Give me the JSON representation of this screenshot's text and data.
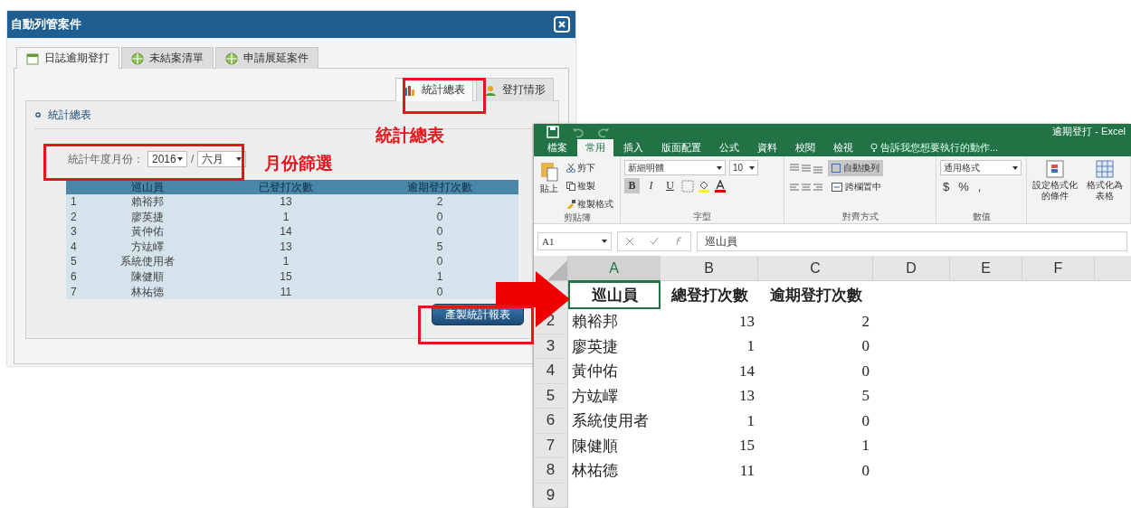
{
  "dialog": {
    "title": "自動列管案件",
    "tabs": [
      {
        "label": "日誌逾期登打",
        "selected": true
      },
      {
        "label": "未結案清單",
        "selected": false
      },
      {
        "label": "申請展延案件",
        "selected": false
      }
    ],
    "sub_tabs": [
      {
        "label": "統計總表",
        "selected": true
      },
      {
        "label": "登打情形",
        "selected": false
      }
    ],
    "section_title": "統計總表",
    "filter": {
      "label": "統計年度月份：",
      "year": "2016",
      "separator": "/",
      "month": "六月"
    },
    "table": {
      "columns": [
        "",
        "巡山員",
        "已登打次數",
        "逾期登打次數"
      ],
      "rows": [
        [
          "1",
          "賴裕邦",
          "13",
          "2"
        ],
        [
          "2",
          "廖英捷",
          "1",
          "0"
        ],
        [
          "3",
          "黃仲佑",
          "14",
          "0"
        ],
        [
          "4",
          "方竑嶧",
          "13",
          "5"
        ],
        [
          "5",
          "系統使用者",
          "1",
          "0"
        ],
        [
          "6",
          "陳健順",
          "15",
          "1"
        ],
        [
          "7",
          "林祐德",
          "11",
          "0"
        ]
      ]
    },
    "button": "產製統計報表"
  },
  "callouts": [
    "統計總表",
    "月份篩選"
  ],
  "excel": {
    "title": "逾期登打 - Excel",
    "tabs": [
      {
        "label": "檔案",
        "selected": false
      },
      {
        "label": "常用",
        "selected": true
      },
      {
        "label": "插入",
        "selected": false
      },
      {
        "label": "版面配置",
        "selected": false
      },
      {
        "label": "公式",
        "selected": false
      },
      {
        "label": "資料",
        "selected": false
      },
      {
        "label": "校閱",
        "selected": false
      },
      {
        "label": "檢視",
        "selected": false
      }
    ],
    "tell_me": "告訴我您想要執行的動作...",
    "ribbon": {
      "paste": "貼上",
      "cut": "剪下",
      "copy": "複製",
      "format_painter": "複製格式",
      "clipboard": "剪貼簿",
      "font_name": "新細明體",
      "font_size": "10",
      "bold": "B",
      "italic": "I",
      "underline": "U",
      "font": "字型",
      "wrap": "自動換列",
      "merge": "跨欄置中",
      "alignment": "對齊方式",
      "number_format": "通用格式",
      "currency": "$",
      "percent": "%",
      "comma": ",",
      "number": "數值",
      "conditional": "設定格式化的條件",
      "format_table": "格式化為表格"
    },
    "name_box": "A1",
    "formula": "巡山員",
    "columns": [
      {
        "label": "A",
        "selected": true
      },
      {
        "label": "B",
        "selected": false
      },
      {
        "label": "C",
        "selected": false
      },
      {
        "label": "D",
        "selected": false
      },
      {
        "label": "E",
        "selected": false
      },
      {
        "label": "F",
        "selected": false
      }
    ],
    "header_row": [
      "巡山員",
      "總登打次數",
      "逾期登打次數"
    ],
    "rows": [
      {
        "number": "2",
        "cells": [
          "賴裕邦",
          "13",
          "2"
        ]
      },
      {
        "number": "3",
        "cells": [
          "廖英捷",
          "1",
          "0"
        ]
      },
      {
        "number": "4",
        "cells": [
          "黃仲佑",
          "14",
          "0"
        ]
      },
      {
        "number": "5",
        "cells": [
          "方竑嶧",
          "13",
          "5"
        ]
      },
      {
        "number": "6",
        "cells": [
          "系統使用者",
          "1",
          "0"
        ]
      },
      {
        "number": "7",
        "cells": [
          "陳健順",
          "15",
          "1"
        ]
      },
      {
        "number": "8",
        "cells": [
          "林祐德",
          "11",
          "0"
        ]
      },
      {
        "number": "9"
      }
    ]
  }
}
